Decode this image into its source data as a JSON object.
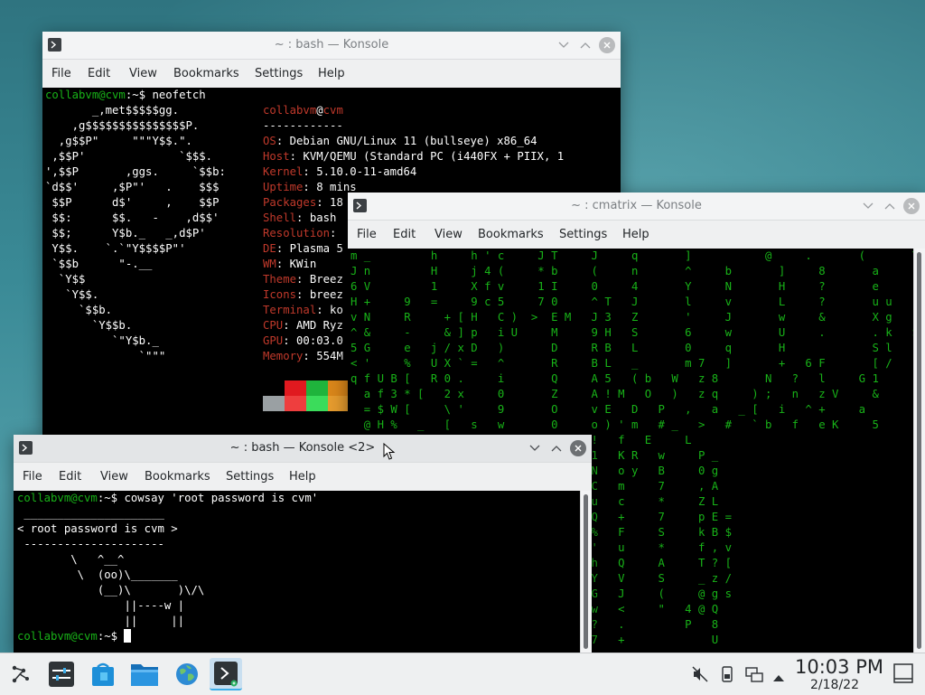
{
  "neofetch_window": {
    "title": "~ : bash — Konsole",
    "menu": [
      "File",
      "Edit",
      "View",
      "Bookmarks",
      "Settings",
      "Help"
    ],
    "prompt_user": "collabvm@cvm",
    "prompt_path": ":~$ ",
    "command": "neofetch",
    "logo_lines": [
      "       _,met$$$$$gg.",
      "    ,g$$$$$$$$$$$$$$$P.",
      "  ,g$$P\"     \"\"\"Y$$.\".",
      " ,$$P'              `$$$.",
      "',$$P       ,ggs.     `$$b:",
      "`d$$'     ,$P\"'   .    $$$",
      " $$P      d$'     ,    $$P",
      " $$:      $$.   -    ,d$$'",
      " $$;      Y$b._   _,d$P'",
      " Y$$.    `.`\"Y$$$$P\"'",
      " `$$b      \"-.__",
      "  `Y$$",
      "   `Y$$.",
      "     `$$b.",
      "       `Y$$b.",
      "          `\"Y$b._",
      "              `\"\"\""
    ],
    "info_header_user": "collabvm",
    "info_header_at": "@",
    "info_header_host": "cvm",
    "info_separator": "------------",
    "info": [
      {
        "k": "OS",
        "v": "Debian GNU/Linux 11 (bullseye) x86_64"
      },
      {
        "k": "Host",
        "v": "KVM/QEMU (Standard PC (i440FX + PIIX, 1"
      },
      {
        "k": "Kernel",
        "v": "5.10.0-11-amd64"
      },
      {
        "k": "Uptime",
        "v": "8 mins"
      },
      {
        "k": "Packages",
        "v": "18"
      },
      {
        "k": "Shell",
        "v": "bash"
      },
      {
        "k": "Resolution",
        "v": ""
      },
      {
        "k": "DE",
        "v": "Plasma 5"
      },
      {
        "k": "WM",
        "v": "KWin"
      },
      {
        "k": "Theme",
        "v": "Breez"
      },
      {
        "k": "Icons",
        "v": "breez"
      },
      {
        "k": "Terminal",
        "v": "ko"
      },
      {
        "k": "CPU",
        "v": "AMD Ryz"
      },
      {
        "k": "GPU",
        "v": "00:03.0"
      },
      {
        "k": "Memory",
        "v": "554M"
      }
    ],
    "palette_top": [
      "#000000",
      "#e0191f",
      "#1fb43c",
      "#d9861a"
    ],
    "palette_bottom": [
      "#9aa0a3",
      "#ee3e3e",
      "#3bdc5b",
      "#e59b2e"
    ]
  },
  "cmatrix_window": {
    "title": "~ : cmatrix — Konsole",
    "menu": [
      "File",
      "Edit",
      "View",
      "Bookmarks",
      "Settings",
      "Help"
    ],
    "rows": [
      "m _         h     h ' c     J T     J     q       ]           @     .       (       Y",
      "J n         H     j 4 (     * b     (     n       ^     b       ]     8       a       .",
      "6 V         1     X f v     1 I     0     4       Y     N       H     ?       e       L",
      "H +     9   =     9 c 5     7 0     ^ T   J       l     v       L     ?       u u     >",
      "v N     R     + [ H   C )  >  E M   J 3   Z       '     J       w     &       X g     ^",
      "^ &     -     & ] p   i U     M     9 H   S       6     w       U     .       . k   S",
      "5 G     e   j / x D   )       D     R B   L       0     q       H             S l",
      "< '     %   U X ` =   ^       R     B L   _       m 7   ]       +   6 F       [ /",
      "q f U B [   R 0 .     i       Q     A 5   ( b   W   z 8       N   ?   l     G 1",
      "  a f 3 * [   2 x     0       Z     A ! M   O   )   z q     ) ;   n   z V     &",
      "  = $ W [     \\ '     9       O     v E   D   P   ,   a   _ [   i   ^ +     a",
      "  @ H %   _   [   s   w       0     o ) ' m   # _   >   #   ` b   f   e K     5",
      "",
      "",
      "< Y T =       7       P L     W     !   f   E     L",
      "z e = d       -       f k     W     1   K R   w     P _",
      "K V 6 c       1       + h     \\     N   o y   B     0 g",
      "M % w         Z       7 >     b     C   m     7     , A",
      "+ T p         [       [ u     f     u   c     *     Z L",
      "A +   )       #       B I     '     Q   +     7     p E =",
      "_ a V         X       T V     a     %   F     S     k B $",
      "[ m X         2       ( < )         '   u     *     f , v",
      "e [   G       :       ( @ ~         h   Q     A     T ? [",
      ">   t   + l           &             Y   V     S     _ z /",
      "<   `     4 v         ]             G   J     (     @ g s",
      "  R m w h     N       7             w   <     \"   4 @ Q",
      "\\ H q d       J       t N           ?   .         P   8",
      "T   < . +     c       d v V         7   +             U"
    ]
  },
  "cowsay_window": {
    "title": "~ : bash — Konsole <2>",
    "menu": [
      "File",
      "Edit",
      "View",
      "Bookmarks",
      "Settings",
      "Help"
    ],
    "prompt_user": "collabvm@cvm",
    "prompt_path": ":~$ ",
    "command": "cowsay 'root password is cvm'",
    "output": [
      " _____________________",
      "< root password is cvm >",
      " ---------------------",
      "        \\   ^__^",
      "         \\  (oo)\\_______",
      "            (__)\\       )\\/\\",
      "                ||----w |",
      "                ||     ||"
    ],
    "final_prompt_user": "collabvm@cvm",
    "final_prompt_path": ":~$ "
  },
  "taskbar": {
    "time": "10:03 PM",
    "date": "2/18/22",
    "icons": [
      "application-launcher-icon",
      "system-settings-icon",
      "discover-icon",
      "dolphin-file-manager-icon",
      "web-browser-icon",
      "konsole-icon"
    ],
    "tray": [
      "volume-muted-icon",
      "removable-device-icon",
      "network-wired-icon",
      "show-hidden-icons-arrow"
    ]
  }
}
